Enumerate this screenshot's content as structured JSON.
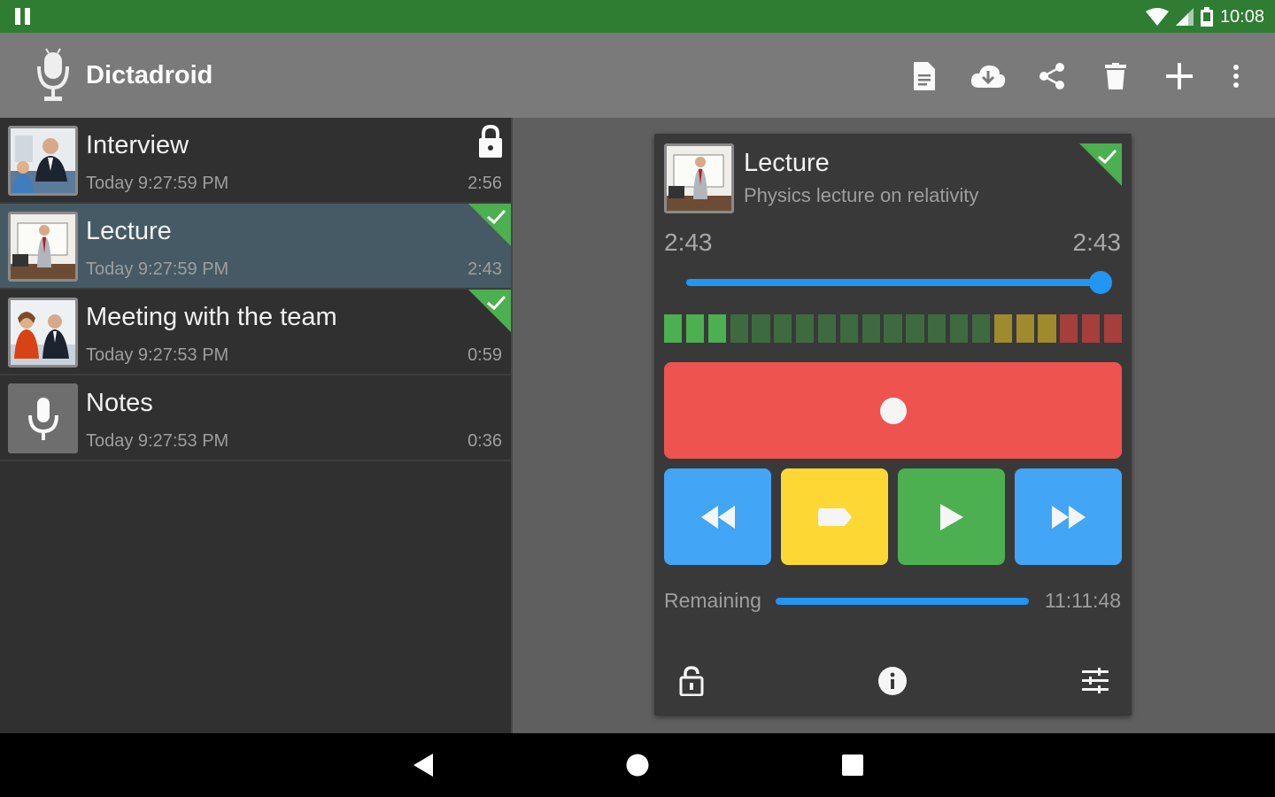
{
  "status_bar": {
    "time": "10:08",
    "icons": [
      "pause-icon",
      "wifi-icon",
      "signal-icon",
      "battery-icon"
    ]
  },
  "app_bar": {
    "title": "Dictadroid",
    "actions": [
      "document-icon",
      "cloud-download-icon",
      "share-icon",
      "delete-icon",
      "add-icon",
      "more-vert-icon"
    ]
  },
  "recordings": [
    {
      "title": "Interview",
      "date": "Today 9:27:59 PM",
      "duration": "2:56",
      "locked": true,
      "done": false,
      "selected": false,
      "thumb": "photo"
    },
    {
      "title": "Lecture",
      "date": "Today 9:27:59 PM",
      "duration": "2:43",
      "locked": false,
      "done": true,
      "selected": true,
      "thumb": "photo"
    },
    {
      "title": "Meeting with the team",
      "date": "Today 9:27:53 PM",
      "duration": "0:59",
      "locked": false,
      "done": true,
      "selected": false,
      "thumb": "photo"
    },
    {
      "title": "Notes",
      "date": "Today 9:27:53 PM",
      "duration": "0:36",
      "locked": false,
      "done": false,
      "selected": false,
      "thumb": "mic-icon"
    }
  ],
  "player": {
    "title": "Lecture",
    "subtitle": "Physics lecture on relativity",
    "position": "2:43",
    "length": "2:43",
    "progress": 1.0,
    "meter_levels": 21,
    "remaining_label": "Remaining",
    "remaining_value": "11:11:48",
    "controls": [
      "rewind-icon",
      "mark-icon",
      "play-icon",
      "fast-forward-icon"
    ],
    "colors": {
      "record": "#ef5350",
      "rewind": "#42a5f5",
      "mark": "#fdd835",
      "play": "#4caf50",
      "forward": "#42a5f5",
      "accent": "#2196f3"
    },
    "bottom_actions": [
      "lock-icon",
      "info-icon",
      "equalizer-icon"
    ]
  },
  "colors": {
    "status_bar": "#2e7d32",
    "app_bar": "#7a7a7a",
    "list_bg": "#303030",
    "selected_row": "#455a64",
    "check": "#4caf50"
  }
}
